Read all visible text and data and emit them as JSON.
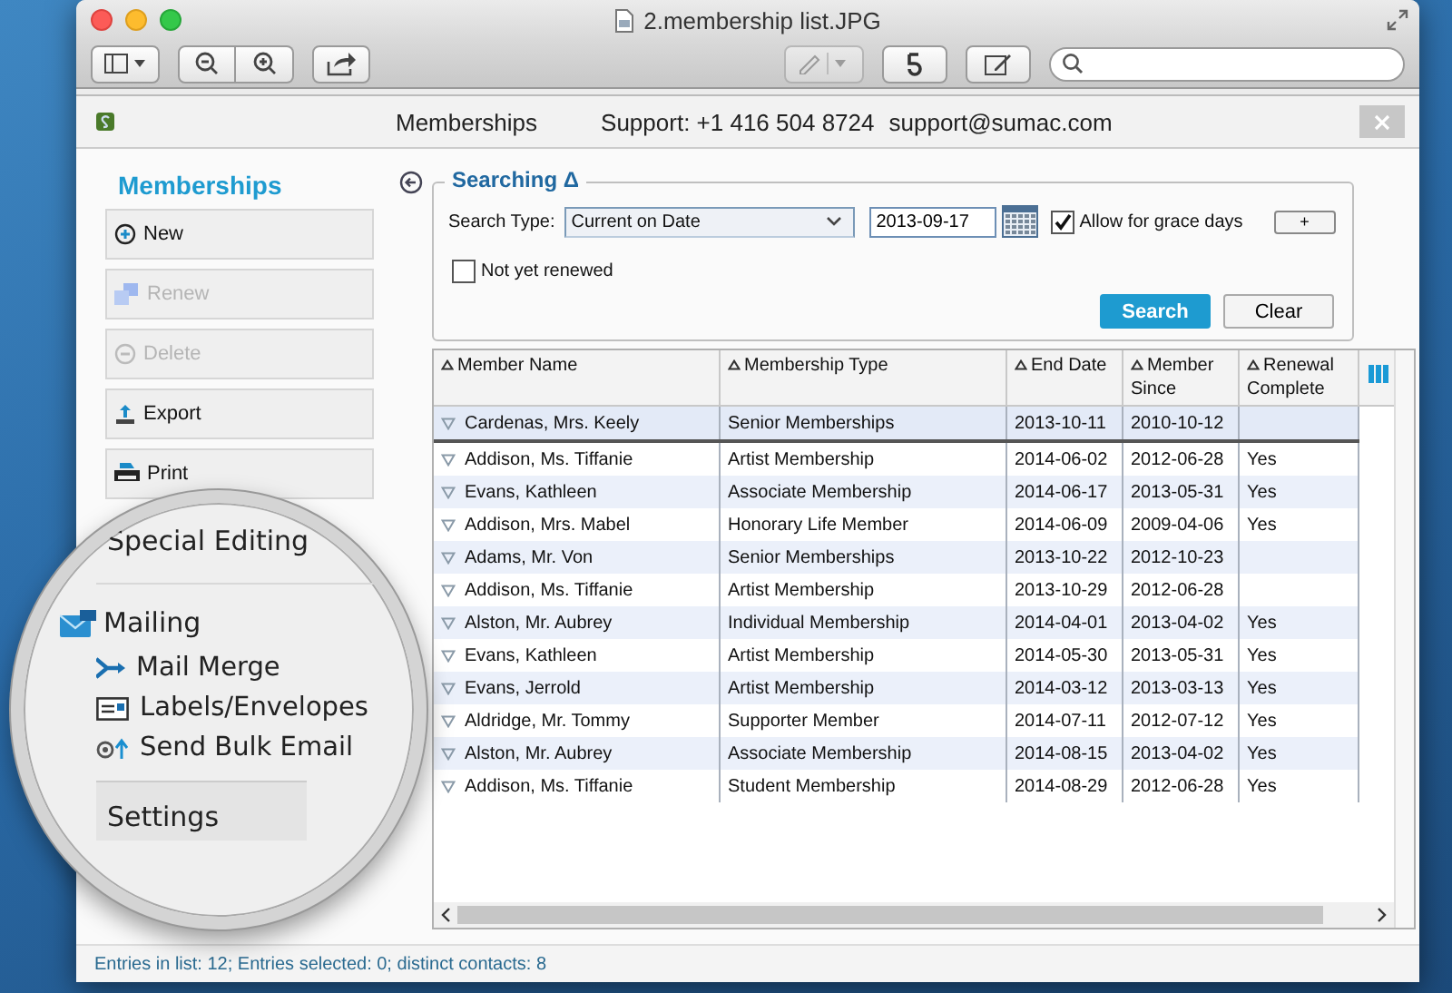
{
  "window": {
    "title": "2.membership list.JPG"
  },
  "app_header": {
    "title": "Memberships",
    "phone": "Support: +1 416 504 8724",
    "email": "support@sumac.com"
  },
  "sidebar": {
    "title": "Memberships",
    "actions": [
      {
        "label": "New",
        "kind": "new",
        "disabled": false
      },
      {
        "label": "Renew",
        "kind": "renew",
        "disabled": true
      },
      {
        "label": "Delete",
        "kind": "delete",
        "disabled": true
      },
      {
        "label": "Export",
        "kind": "export",
        "disabled": false
      },
      {
        "label": "Print",
        "kind": "print",
        "disabled": false
      }
    ]
  },
  "magnifier": {
    "items": [
      {
        "label": "Special Editing",
        "kind": "section"
      },
      {
        "label": "Mailing",
        "kind": "group"
      },
      {
        "label": "Mail Merge",
        "kind": "merge"
      },
      {
        "label": "Labels/Envelopes",
        "kind": "labels"
      },
      {
        "label": "Send Bulk Email",
        "kind": "email"
      },
      {
        "label": "Settings",
        "kind": "section"
      }
    ]
  },
  "search": {
    "title": "Searching Δ",
    "type_label": "Search Type:",
    "type_value": "Current on Date",
    "date": "2013-09-17",
    "grace": {
      "label": "Allow for grace days",
      "checked": true
    },
    "plus_button": "+",
    "not_renewed": {
      "label": "Not yet renewed",
      "checked": false
    },
    "buttons": [
      {
        "label": "Search",
        "kind": "primary"
      },
      {
        "label": "Clear",
        "kind": "secondary"
      }
    ]
  },
  "table": {
    "columns": [
      "Member Name",
      "Membership Type",
      "End Date",
      "Member Since",
      "Renewal Complete"
    ],
    "rows": [
      {
        "cells": [
          "Cardenas, Mrs. Keely",
          "Senior Memberships",
          "2013-10-11",
          "2010-10-12",
          ""
        ],
        "selected": true
      },
      {
        "cells": [
          "Addison, Ms. Tiffanie",
          "Artist Membership",
          "2014-06-02",
          "2012-06-28",
          "Yes"
        ],
        "selected": false
      },
      {
        "cells": [
          "Evans, Kathleen",
          "Associate Membership",
          "2014-06-17",
          "2013-05-31",
          "Yes"
        ],
        "selected": false
      },
      {
        "cells": [
          "Addison, Mrs. Mabel",
          "Honorary Life Member",
          "2014-06-09",
          "2009-04-06",
          "Yes"
        ],
        "selected": false
      },
      {
        "cells": [
          "Adams, Mr. Von",
          "Senior Memberships",
          "2013-10-22",
          "2012-10-23",
          ""
        ],
        "selected": false
      },
      {
        "cells": [
          "Addison, Ms. Tiffanie",
          "Artist Membership",
          "2013-10-29",
          "2012-06-28",
          ""
        ],
        "selected": false
      },
      {
        "cells": [
          "Alston, Mr. Aubrey",
          "Individual Membership",
          "2014-04-01",
          "2013-04-02",
          "Yes"
        ],
        "selected": false
      },
      {
        "cells": [
          "Evans, Kathleen",
          "Artist Membership",
          "2014-05-30",
          "2013-05-31",
          "Yes"
        ],
        "selected": false
      },
      {
        "cells": [
          "Evans, Jerrold",
          "Artist Membership",
          "2014-03-12",
          "2013-03-13",
          "Yes"
        ],
        "selected": false
      },
      {
        "cells": [
          "Aldridge, Mr. Tommy",
          "Supporter Member",
          "2014-07-11",
          "2012-07-12",
          "Yes"
        ],
        "selected": false
      },
      {
        "cells": [
          "Alston, Mr. Aubrey",
          "Associate Membership",
          "2014-08-15",
          "2013-04-02",
          "Yes"
        ],
        "selected": false
      },
      {
        "cells": [
          "Addison, Ms. Tiffanie",
          "Student Membership",
          "2014-08-29",
          "2012-06-28",
          "Yes"
        ],
        "selected": false
      }
    ]
  },
  "status_bar": "Entries in list: 12; Entries selected: 0; distinct contacts: 8"
}
